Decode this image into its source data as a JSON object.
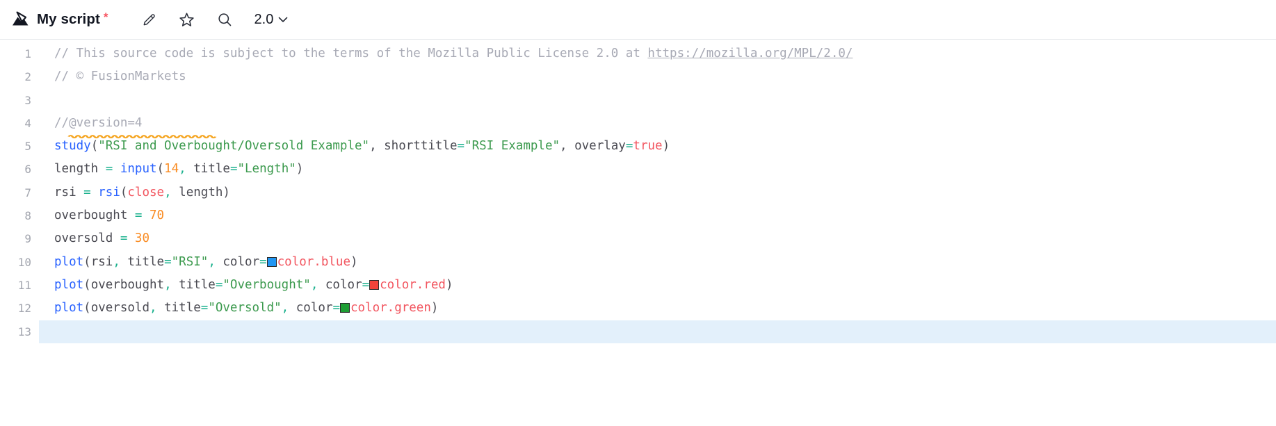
{
  "header": {
    "logo_icon": "mountain-peak-logo",
    "title": "My script",
    "unsaved_marker": "*",
    "edit_icon": "pencil-icon",
    "favorite_icon": "star-icon",
    "search_icon": "search-icon",
    "version_label": "2.0",
    "version_chevron_icon": "chevron-down-icon"
  },
  "editor": {
    "active_line": 13,
    "colors": {
      "comment": "#a8aab5",
      "function": "#2962ff",
      "string": "#3c9a4e",
      "number": "#f98c24",
      "constant": "#f2555f",
      "operator": "#18b08c",
      "plain": "#4a4a52",
      "active_line_bg": "#e3f0fb",
      "squiggle": "#f5a623",
      "swatch_blue": "#2196f3",
      "swatch_red": "#f4433a",
      "swatch_green": "#1e9e34"
    },
    "line_numbers": [
      "1",
      "2",
      "3",
      "4",
      "5",
      "6",
      "7",
      "8",
      "9",
      "10",
      "11",
      "12",
      "13"
    ],
    "lines": [
      {
        "number": "1",
        "tokens": [
          {
            "t": "comment",
            "v": "// This source code is subject to the terms of the Mozilla Public License 2.0 at "
          },
          {
            "t": "url",
            "v": "https://mozilla.org/MPL/2.0/"
          }
        ]
      },
      {
        "number": "2",
        "tokens": [
          {
            "t": "comment",
            "v": "// © FusionMarkets"
          }
        ]
      },
      {
        "number": "3",
        "tokens": []
      },
      {
        "number": "4",
        "tokens": [
          {
            "t": "comment",
            "v": "//"
          },
          {
            "t": "comment-squiggle",
            "v": "@version=4"
          }
        ]
      },
      {
        "number": "5",
        "tokens": [
          {
            "t": "fn",
            "v": "study"
          },
          {
            "t": "punct",
            "v": "("
          },
          {
            "t": "str",
            "v": "\"RSI and Overbought/Oversold Example\""
          },
          {
            "t": "punct",
            "v": ", "
          },
          {
            "t": "plain",
            "v": "shorttitle"
          },
          {
            "t": "op",
            "v": "="
          },
          {
            "t": "str",
            "v": "\"RSI Example\""
          },
          {
            "t": "punct",
            "v": ", "
          },
          {
            "t": "plain",
            "v": "overlay"
          },
          {
            "t": "op",
            "v": "="
          },
          {
            "t": "const",
            "v": "true"
          },
          {
            "t": "punct",
            "v": ")"
          }
        ]
      },
      {
        "number": "6",
        "tokens": [
          {
            "t": "plain",
            "v": "length "
          },
          {
            "t": "op",
            "v": "="
          },
          {
            "t": "plain",
            "v": " "
          },
          {
            "t": "fn",
            "v": "input"
          },
          {
            "t": "punct",
            "v": "("
          },
          {
            "t": "num",
            "v": "14"
          },
          {
            "t": "op",
            "v": ","
          },
          {
            "t": "plain",
            "v": " title"
          },
          {
            "t": "op",
            "v": "="
          },
          {
            "t": "str",
            "v": "\"Length\""
          },
          {
            "t": "punct",
            "v": ")"
          }
        ]
      },
      {
        "number": "7",
        "tokens": [
          {
            "t": "plain",
            "v": "rsi "
          },
          {
            "t": "op",
            "v": "="
          },
          {
            "t": "plain",
            "v": " "
          },
          {
            "t": "fn",
            "v": "rsi"
          },
          {
            "t": "punct",
            "v": "("
          },
          {
            "t": "const",
            "v": "close"
          },
          {
            "t": "op",
            "v": ","
          },
          {
            "t": "plain",
            "v": " length"
          },
          {
            "t": "punct",
            "v": ")"
          }
        ]
      },
      {
        "number": "8",
        "tokens": [
          {
            "t": "plain",
            "v": "overbought "
          },
          {
            "t": "op",
            "v": "="
          },
          {
            "t": "plain",
            "v": " "
          },
          {
            "t": "num",
            "v": "70"
          }
        ]
      },
      {
        "number": "9",
        "tokens": [
          {
            "t": "plain",
            "v": "oversold "
          },
          {
            "t": "op",
            "v": "="
          },
          {
            "t": "plain",
            "v": " "
          },
          {
            "t": "num",
            "v": "30"
          }
        ]
      },
      {
        "number": "10",
        "tokens": [
          {
            "t": "fn",
            "v": "plot"
          },
          {
            "t": "punct",
            "v": "("
          },
          {
            "t": "plain",
            "v": "rsi"
          },
          {
            "t": "op",
            "v": ","
          },
          {
            "t": "plain",
            "v": " title"
          },
          {
            "t": "op",
            "v": "="
          },
          {
            "t": "str",
            "v": "\"RSI\""
          },
          {
            "t": "op",
            "v": ","
          },
          {
            "t": "plain",
            "v": " color"
          },
          {
            "t": "op",
            "v": "="
          },
          {
            "t": "swatch",
            "v": "#2196f3"
          },
          {
            "t": "const",
            "v": "color.blue"
          },
          {
            "t": "punct",
            "v": ")"
          }
        ]
      },
      {
        "number": "11",
        "tokens": [
          {
            "t": "fn",
            "v": "plot"
          },
          {
            "t": "punct",
            "v": "("
          },
          {
            "t": "plain",
            "v": "overbought"
          },
          {
            "t": "op",
            "v": ","
          },
          {
            "t": "plain",
            "v": " title"
          },
          {
            "t": "op",
            "v": "="
          },
          {
            "t": "str",
            "v": "\"Overbought\""
          },
          {
            "t": "op",
            "v": ","
          },
          {
            "t": "plain",
            "v": " color"
          },
          {
            "t": "op",
            "v": "="
          },
          {
            "t": "swatch",
            "v": "#f4433a"
          },
          {
            "t": "const",
            "v": "color.red"
          },
          {
            "t": "punct",
            "v": ")"
          }
        ]
      },
      {
        "number": "12",
        "tokens": [
          {
            "t": "fn",
            "v": "plot"
          },
          {
            "t": "punct",
            "v": "("
          },
          {
            "t": "plain",
            "v": "oversold"
          },
          {
            "t": "op",
            "v": ","
          },
          {
            "t": "plain",
            "v": " title"
          },
          {
            "t": "op",
            "v": "="
          },
          {
            "t": "str",
            "v": "\"Oversold\""
          },
          {
            "t": "op",
            "v": ","
          },
          {
            "t": "plain",
            "v": " color"
          },
          {
            "t": "op",
            "v": "="
          },
          {
            "t": "swatch",
            "v": "#1e9e34"
          },
          {
            "t": "const",
            "v": "color.green"
          },
          {
            "t": "punct",
            "v": ")"
          }
        ]
      },
      {
        "number": "13",
        "tokens": []
      }
    ]
  }
}
